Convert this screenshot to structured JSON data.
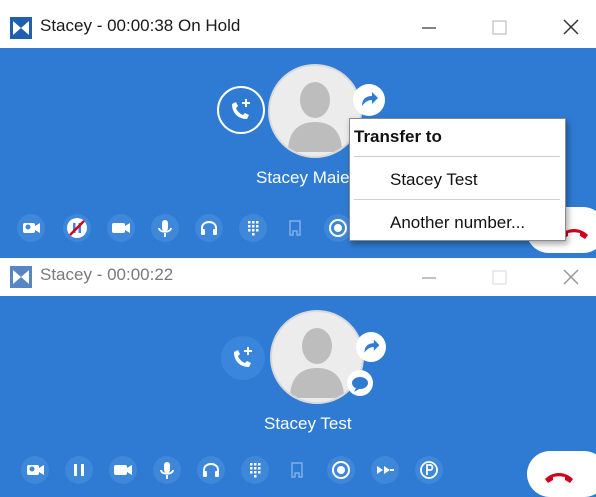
{
  "colors": {
    "panel_blue": "#2f7bd3",
    "hangup_red": "#d0021b",
    "button_blue": "#3f88d9"
  },
  "window1": {
    "title": "Stacey - 00:00:38 On Hold",
    "caller_name": "Stacey Maie",
    "controls": [
      "minimize-icon",
      "maximize-icon",
      "close-icon"
    ],
    "toolbar": [
      "video-contact-icon",
      "no-hold-icon",
      "video-icon",
      "mic-icon",
      "headset-icon",
      "dialpad-icon",
      "transfer-call-icon",
      "record-icon"
    ],
    "transfer_menu": {
      "header": "Transfer to",
      "items": [
        "Stacey Test",
        "Another number..."
      ]
    }
  },
  "window2": {
    "title": "Stacey - 00:00:22",
    "caller_name": "Stacey Test",
    "controls": [
      "minimize-icon",
      "maximize-icon",
      "close-icon"
    ],
    "toolbar": [
      "video-contact-icon",
      "pause-icon",
      "video-icon",
      "mic-icon",
      "headset-icon",
      "dialpad-icon",
      "transfer-call-icon",
      "record-icon",
      "merge-icon",
      "park-icon"
    ]
  }
}
